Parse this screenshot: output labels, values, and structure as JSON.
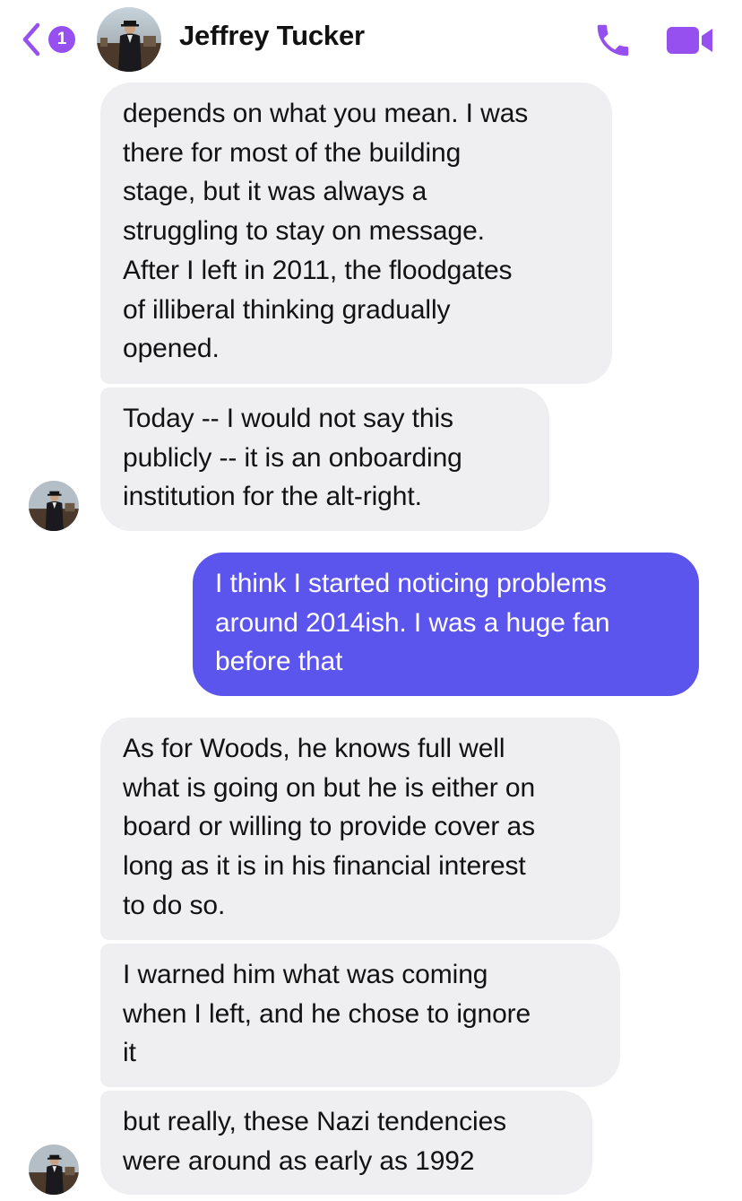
{
  "header": {
    "back_badge": "1",
    "contact_name": "Jeffrey Tucker",
    "icons": {
      "back": "chevron-left-icon",
      "call": "phone-icon",
      "video": "video-camera-icon"
    },
    "accent_color": "#9650f0"
  },
  "messages": [
    {
      "direction": "incoming",
      "text": "depends on what you mean. I was\nthere for most of the building\nstage, but it was always a\nstruggling to stay on message.\nAfter I left in 2011, the floodgates\nof illiberal thinking gradually\nopened."
    },
    {
      "direction": "incoming",
      "text": "Today -- I would not say this\npublicly -- it is an onboarding\ninstitution for the alt-right."
    },
    {
      "direction": "outgoing",
      "text": "I think I started noticing problems\naround 2014ish. I was a huge fan\nbefore that"
    },
    {
      "direction": "incoming",
      "text": "As for Woods, he knows full well\nwhat is going on but he is either on\nboard or willing to provide cover as\nlong as it is in his financial interest\nto do so."
    },
    {
      "direction": "incoming",
      "text": "I warned him what was coming\nwhen I left, and he chose to ignore\nit"
    },
    {
      "direction": "incoming",
      "text": "but really, these Nazi tendencies\nwere around as early as 1992"
    }
  ],
  "colors": {
    "incoming_bubble": "#efeff1",
    "outgoing_bubble": "#5b55ee",
    "icon_purple": "#9650f0"
  }
}
